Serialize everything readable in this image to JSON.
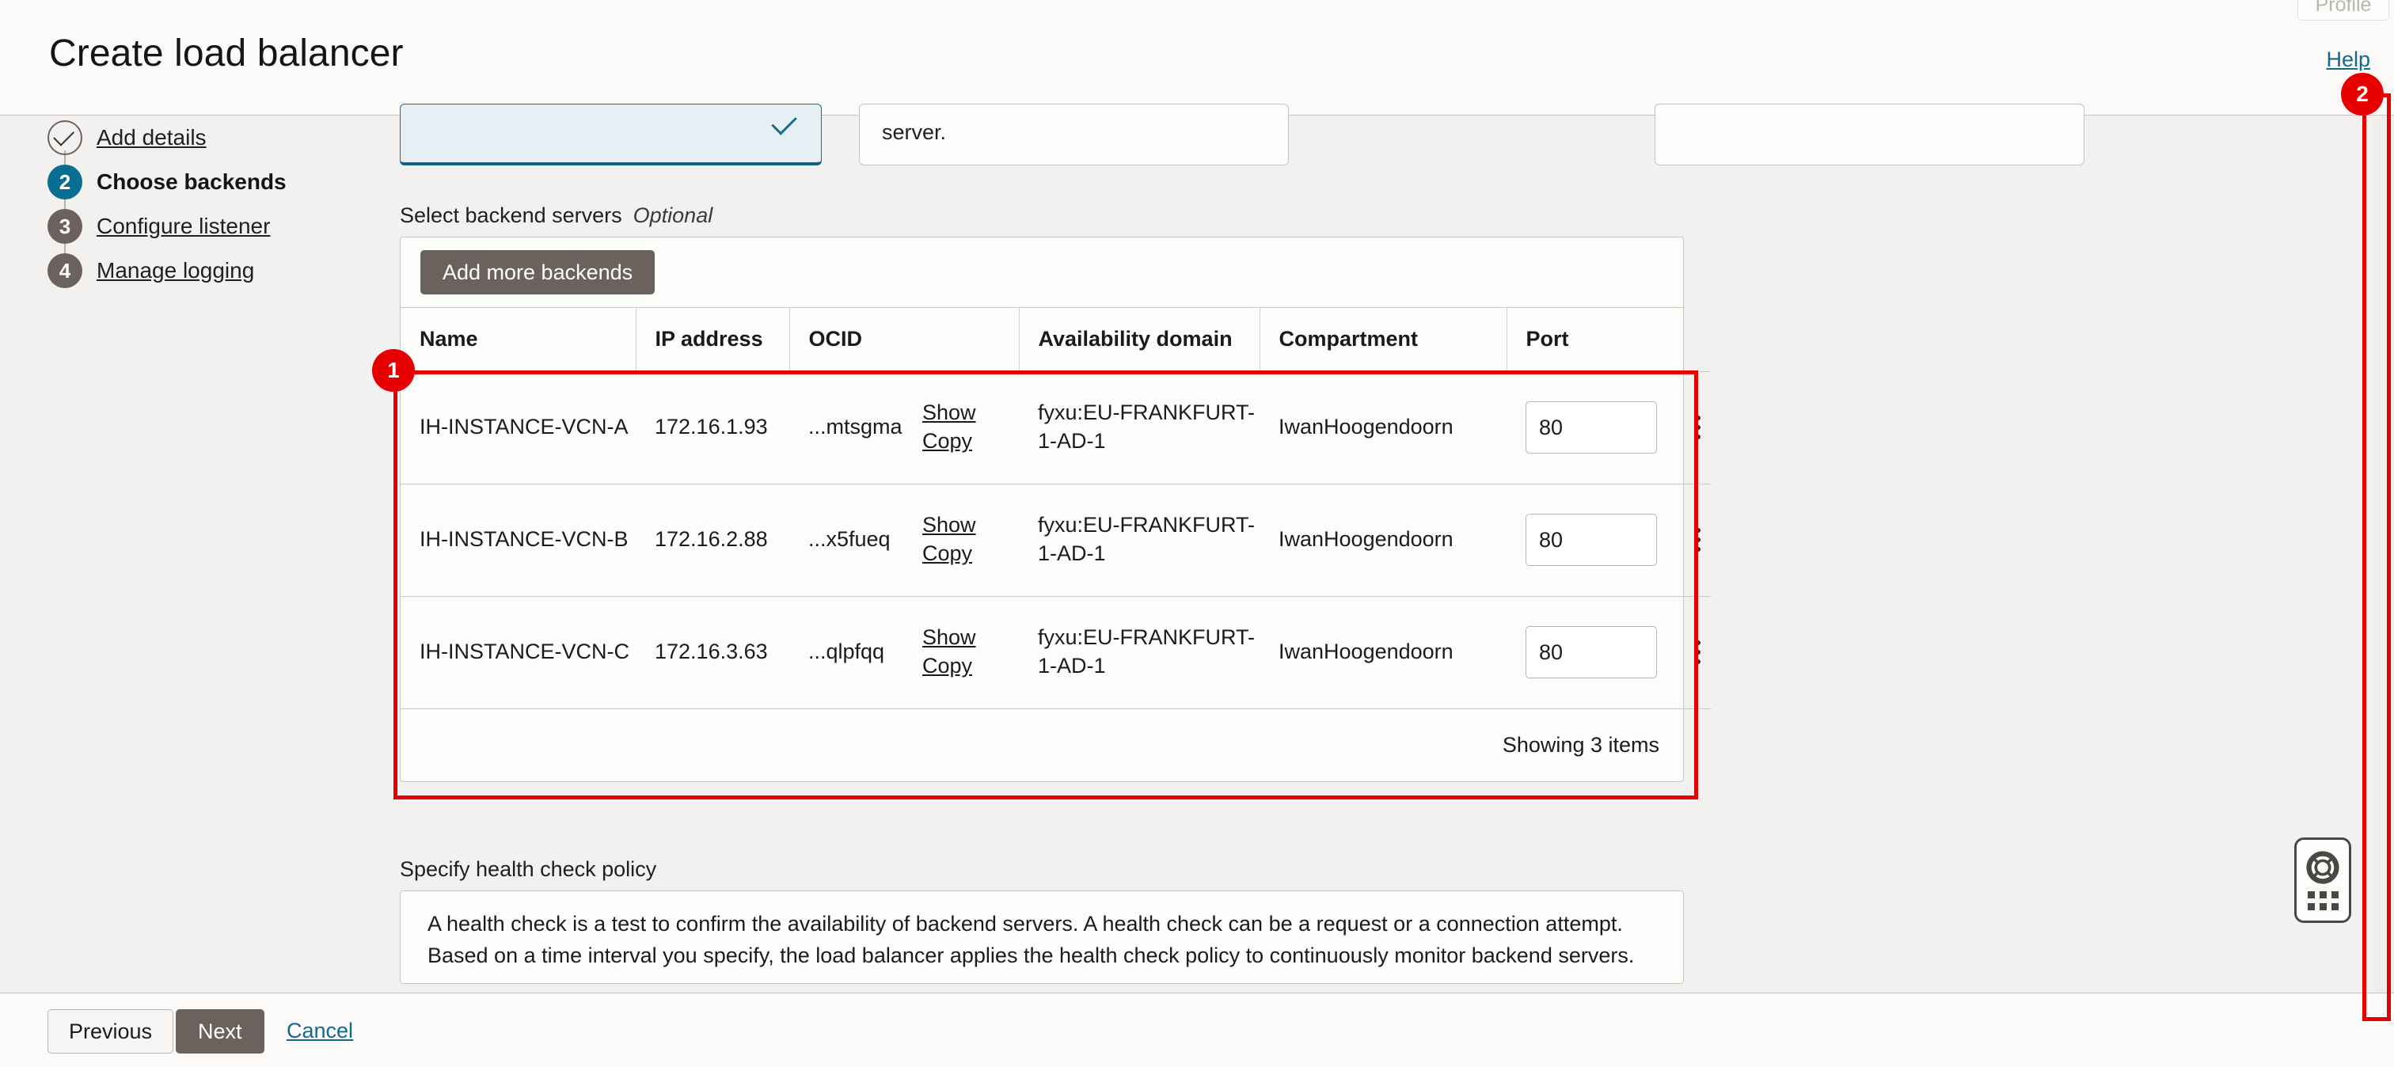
{
  "header": {
    "title": "Create load balancer",
    "help_label": "Help",
    "profile_label": "Profile"
  },
  "sidebar": {
    "steps": [
      {
        "marker": "check",
        "label": "Add details",
        "state": "done"
      },
      {
        "marker": "2",
        "label": "Choose backends",
        "state": "active"
      },
      {
        "marker": "3",
        "label": "Configure listener",
        "state": "todo"
      },
      {
        "marker": "4",
        "label": "Manage logging",
        "state": "todo"
      }
    ]
  },
  "top_cards": {
    "card_b_text": "server."
  },
  "backends": {
    "section_label": "Select backend servers",
    "section_optional": "Optional",
    "add_button": "Add more backends",
    "columns": [
      "Name",
      "IP address",
      "OCID",
      "Availability domain",
      "Compartment",
      "Port"
    ],
    "actions": {
      "show": "Show",
      "copy": "Copy"
    },
    "rows": [
      {
        "name": "IH-INSTANCE-VCN-A",
        "ip": "172.16.1.93",
        "ocid": "...mtsgma",
        "availability_domain": "fyxu:EU-FRANKFURT-1-AD-1",
        "compartment": "IwanHoogendoorn",
        "port": "80"
      },
      {
        "name": "IH-INSTANCE-VCN-B",
        "ip": "172.16.2.88",
        "ocid": "...x5fueq",
        "availability_domain": "fyxu:EU-FRANKFURT-1-AD-1",
        "compartment": "IwanHoogendoorn",
        "port": "80"
      },
      {
        "name": "IH-INSTANCE-VCN-C",
        "ip": "172.16.3.63",
        "ocid": "...qlpfqq",
        "availability_domain": "fyxu:EU-FRANKFURT-1-AD-1",
        "compartment": "IwanHoogendoorn",
        "port": "80"
      }
    ],
    "showing": "Showing 3 items"
  },
  "health_check": {
    "label": "Specify health check policy",
    "description": "A health check is a test to confirm the availability of backend servers. A health check can be a request or a connection attempt. Based on a time interval you specify, the load balancer applies the health check policy to continuously monitor backend servers."
  },
  "footer": {
    "previous": "Previous",
    "next": "Next",
    "cancel": "Cancel"
  },
  "annotations": [
    {
      "badge": "1"
    },
    {
      "badge": "2"
    }
  ],
  "colors": {
    "accent_teal": "#0a6e93",
    "link_teal": "#11698f",
    "button_gray": "#6b615d",
    "annotation_red": "#e60000",
    "page_bg": "#f3f1ef"
  }
}
